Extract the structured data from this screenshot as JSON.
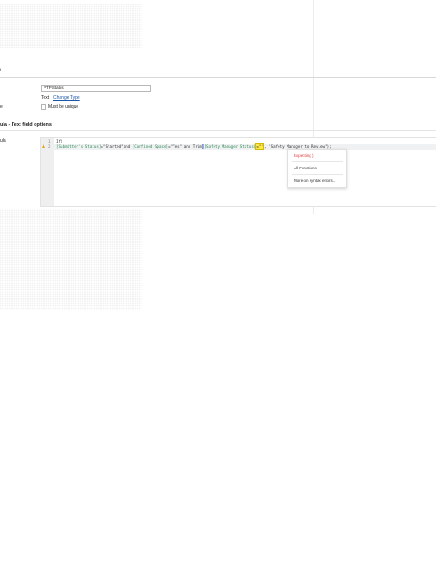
{
  "fields": {
    "name_value": "PTP Status",
    "type_label": "Text",
    "change_type_link": "Change Type",
    "must_be_unique_label": "Must be unique"
  },
  "section": {
    "title": "ula - Text field options",
    "formula_label": "ula"
  },
  "left_labels": {
    "label_a": "i",
    "label_b": "e"
  },
  "editor": {
    "line_numbers": [
      "1",
      "2"
    ],
    "line1": "If(",
    "line2_parts": {
      "field1": "[Submitter's Status]",
      "op1": "=\"Started\"and ",
      "field2": "[Confined Space]",
      "op2": "=\"Yes\" and Trim",
      "cursor": "(",
      "field3": "[Safety Manager Status]",
      "err": "=\"\"",
      "tail": ", \"Safety Manager to Review\");"
    }
  },
  "popup": {
    "error_text": "Expecting )",
    "all_functions": "All Functions",
    "more_on_errors": "More on syntax errors..."
  },
  "colors": {
    "error_text": "#e03a3a",
    "link": "#1a55a8",
    "field_token": "#2e8b57",
    "warning": "#e3a21a",
    "selection": "#7b8ed0",
    "error_highlight": "#ffe94a"
  }
}
